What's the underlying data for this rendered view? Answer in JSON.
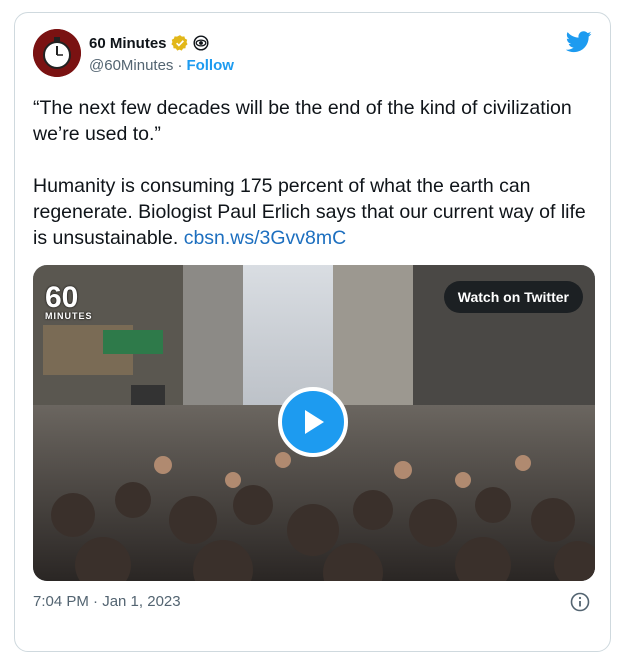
{
  "author": {
    "name": "60 Minutes",
    "handle": "@60Minutes",
    "separator": "·",
    "follow_label": "Follow"
  },
  "tweet": {
    "quote": "“The next few decades will be the end of the kind of civilization we’re used to.”",
    "body": "Humanity is consuming 175 percent of what the earth can regenerate. Biologist Paul Erlich says that our current way of life is unsustainable. ",
    "link": "cbsn.ws/3Gvv8mC"
  },
  "media": {
    "watch_label": "Watch on Twitter",
    "logo_number": "60",
    "logo_text": "MINUTES"
  },
  "footer": {
    "timestamp": "7:04 PM · Jan 1, 2023"
  },
  "icons": {
    "verified": "verified-badge-icon",
    "network": "cbs-eye-icon",
    "platform": "twitter-bird-icon",
    "play": "play-icon",
    "info": "info-icon"
  },
  "colors": {
    "accent": "#1d9bf0",
    "verified": "#e2b719",
    "text": "#0f1419",
    "muted": "#536471"
  }
}
